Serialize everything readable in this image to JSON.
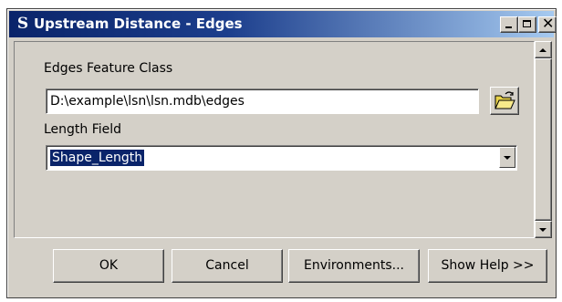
{
  "window": {
    "title": "Upstream Distance - Edges",
    "icon": "S",
    "icon_name": "toolbox-script-icon"
  },
  "title_buttons": {
    "minimize": "minimize-icon",
    "maximize": "maximize-icon",
    "close": "✕"
  },
  "form": {
    "edges_label": "Edges Feature Class",
    "edges_value": "D:\\example\\lsn\\lsn.mdb\\edges",
    "browse_icon": "open-folder-icon",
    "length_label": "Length Field",
    "length_value": "Shape_Length"
  },
  "buttons": {
    "ok": "OK",
    "cancel": "Cancel",
    "environments": "Environments...",
    "show_help": "Show Help >>"
  },
  "colors": {
    "titlebar_start": "#0a246a",
    "titlebar_end": "#a6caf0",
    "face": "#d4d0c8",
    "selection": "#0a246a"
  }
}
